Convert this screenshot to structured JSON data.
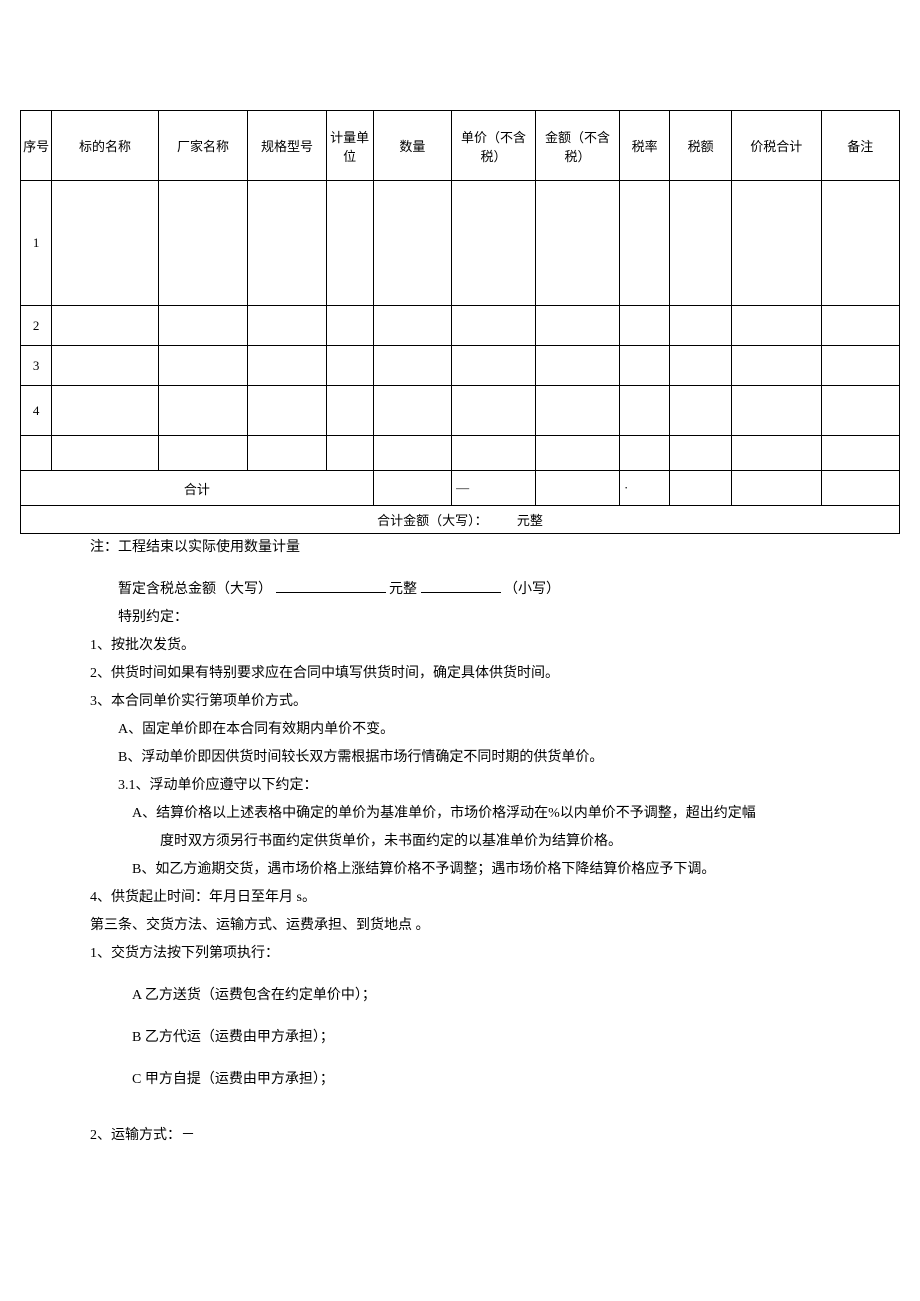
{
  "table": {
    "headers": {
      "seq": "序号",
      "name": "标的名称",
      "factory": "厂家名称",
      "spec": "规格型号",
      "unit": "计量单位",
      "qty": "数量",
      "price": "单价（不含税）",
      "amount": "金额（不含税）",
      "taxrate": "税率",
      "tax": "税额",
      "total": "价税合计",
      "remark": "备注"
    },
    "rows": [
      {
        "seq": "1"
      },
      {
        "seq": "2"
      },
      {
        "seq": "3"
      },
      {
        "seq": "4"
      }
    ],
    "total_row": {
      "label": "合计",
      "price_col": "—",
      "taxrate_col": "·"
    },
    "sum_row": "合计金额（大写）：         元整"
  },
  "body": {
    "note": "注：工程结束以实际使用数量计量",
    "p1_a": "暂定含税总金额（大写）",
    "p1_b": "元整",
    "p1_c": "（小写）",
    "p2": "特别约定：",
    "l1": "1、按批次发货。",
    "l2": "2、供货时间如果有特别要求应在合同中填写供货时间，确定具体供货时间。",
    "l3": "3、本合同单价实行第项单价方式。",
    "l3a": "A、固定单价即在本合同有效期内单价不变。",
    "l3b": "B、浮动单价即因供货时间较长双方需根据市场行情确定不同时期的供货单价。",
    "l31": "3.1、浮动单价应遵守以下约定：",
    "l31a": "A、结算价格以上述表格中确定的单价为基准单价，市场价格浮动在%以内单价不予调整，超出约定幅度时双方须另行书面约定供货单价，未书面约定的以基准单价为结算价格。",
    "l31a_line1": "A、结算价格以上述表格中确定的单价为基准单价，市场价格浮动在%以内单价不予调整，超出约定幅",
    "l31a_line2": "度时双方须另行书面约定供货单价，未书面约定的以基准单价为结算价格。",
    "l31b": "B、如乙方逾期交货，遇市场价格上涨结算价格不予调整；遇市场价格下降结算价格应予下调。",
    "l4": "4、供货起止时间：年月日至年月 s。",
    "art3": "第三条、交货方法、运输方式、运费承担、到货地点 。",
    "a3_1": "1、交货方法按下列第项执行：",
    "a3_1a": "A 乙方送货（运费包含在约定单价中）；",
    "a3_1b": "B 乙方代运（运费由甲方承担）；",
    "a3_1c": "C 甲方自提（运费由甲方承担）；",
    "a3_2": "2、运输方式：－"
  }
}
